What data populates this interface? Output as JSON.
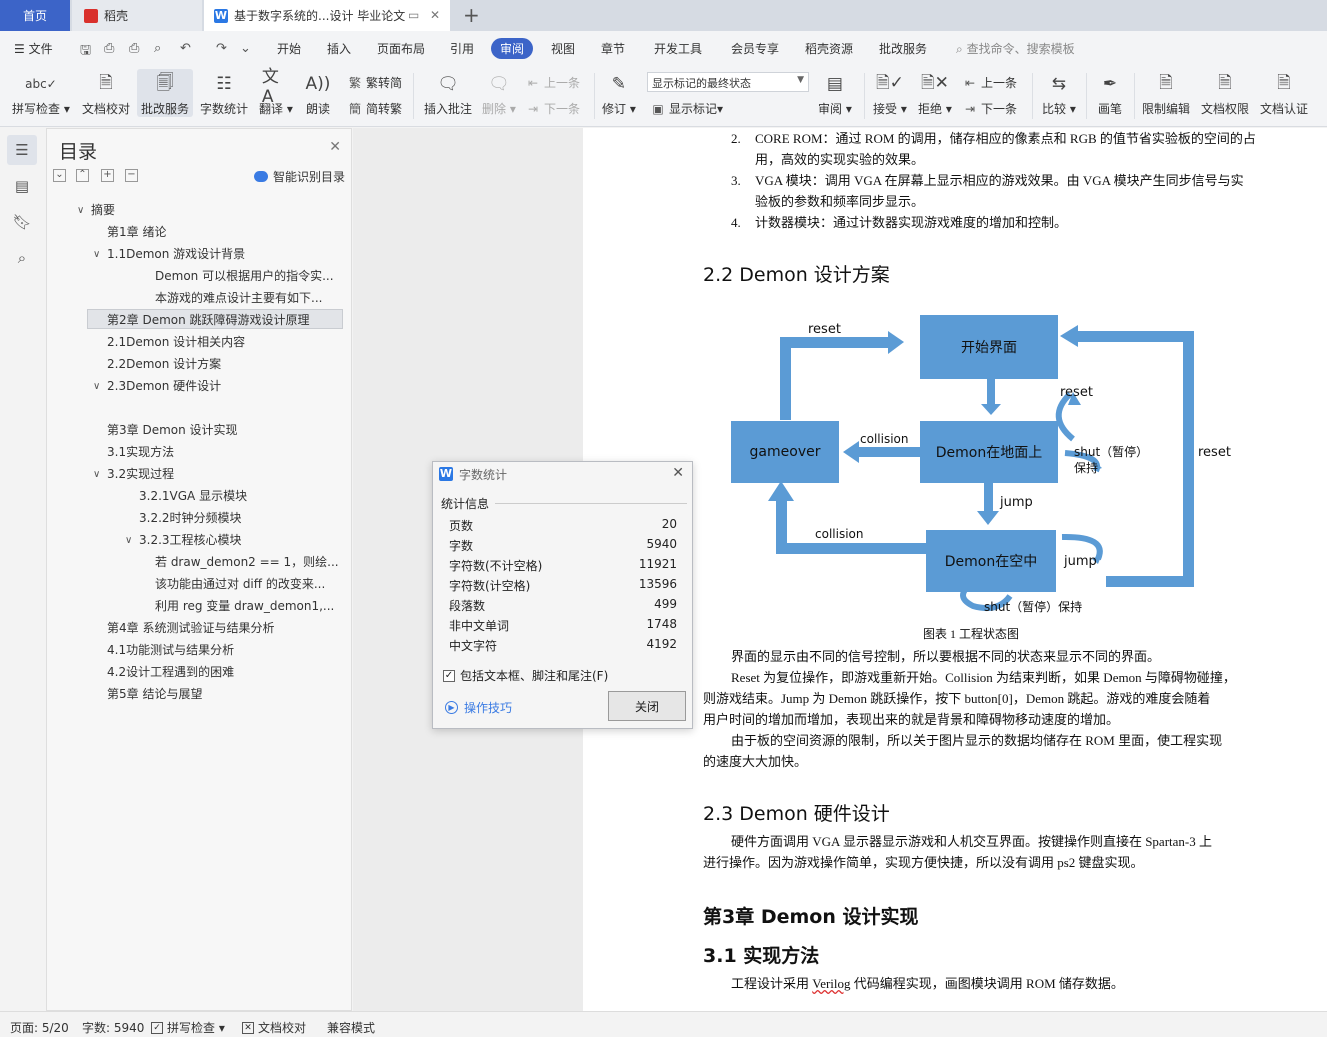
{
  "tabs": {
    "home": "首页",
    "daoke": "稻壳",
    "document": "基于数字系统的...设计 毕业论文"
  },
  "menu": {
    "file": "文件",
    "items": [
      "开始",
      "插入",
      "页面布局",
      "引用",
      "审阅",
      "视图",
      "章节",
      "开发工具",
      "会员专享",
      "稻壳资源",
      "批改服务"
    ],
    "active": "审阅",
    "search_placeholder": "查找命令、搜索模板"
  },
  "ribbon": {
    "spellcheck": "拼写检查",
    "doc_proof": "文档校对",
    "correction_service": "批改服务",
    "word_count": "字数统计",
    "translate": "翻译",
    "read_aloud": "朗读",
    "trad_to_simp": "繁转简",
    "simp_to_trad": "简转繁",
    "insert_comment": "插入批注",
    "delete": "删除",
    "prev_comment": "上一条",
    "next_comment": "下一条",
    "track_changes": "修订",
    "markup_state": "显示标记的最终状态",
    "show_markup": "显示标记",
    "review": "审阅",
    "accept": "接受",
    "reject": "拒绝",
    "prev_change": "上一条",
    "next_change": "下一条",
    "compare": "比较",
    "pen": "画笔",
    "restrict_edit": "限制编辑",
    "doc_permission": "文档权限",
    "doc_certify": "文档认证"
  },
  "toc": {
    "title": "目录",
    "smart_toc": "智能识别目录",
    "items": [
      {
        "text": "摘要"
      },
      {
        "text": "第1章 绪论"
      },
      {
        "text": "1.1Demon 游戏设计背景"
      },
      {
        "text": "Demon 可以根据用户的指令实..."
      },
      {
        "text": "本游戏的难点设计主要有如下..."
      },
      {
        "text": "第2章 Demon 跳跃障碍游戏设计原理"
      },
      {
        "text": "2.1Demon 设计相关内容"
      },
      {
        "text": "2.2Demon 设计方案"
      },
      {
        "text": "2.3Demon 硬件设计"
      },
      {
        "text": "第3章 Demon 设计实现"
      },
      {
        "text": "3.1实现方法"
      },
      {
        "text": "3.2实现过程"
      },
      {
        "text": "3.2.1VGA 显示模块"
      },
      {
        "text": "3.2.2时钟分频模块"
      },
      {
        "text": "3.2.3工程核心模块"
      },
      {
        "text": "若 draw_demon2 == 1，则绘..."
      },
      {
        "text": "该功能由通过对 diff 的改变来..."
      },
      {
        "text": "利用 reg 变量 draw_demon1,..."
      },
      {
        "text": "第4章 系统测试验证与结果分析"
      },
      {
        "text": "4.1功能测试与结果分析"
      },
      {
        "text": "4.2设计工程遇到的困难"
      },
      {
        "text": "第5章 结论与展望"
      }
    ]
  },
  "document": {
    "list_items": [
      {
        "num": "2.",
        "line1": "CORE ROM：通过 ROM 的调用，储存相应的像素点和 RGB 的值节省实验板的空间的占",
        "line2": "用，高效的实现实验的效果。"
      },
      {
        "num": "3.",
        "line1": "VGA 模块：调用 VGA 在屏幕上显示相应的游戏效果。由 VGA 模块产生同步信号与实",
        "line2": "验板的参数和频率同步显示。"
      },
      {
        "num": "4.",
        "line1": "计数器模块：通过计数器实现游戏难度的增加和控制。",
        "line2": ""
      }
    ],
    "h_22": "2.2 Demon 设计方案",
    "diagram": {
      "start": "开始界面",
      "ground": "Demon在地面上",
      "gameover": "gameover",
      "air": "Demon在空中",
      "reset_top": "reset",
      "reset_mid": "reset",
      "reset_right": "reset",
      "collision_top": "collision",
      "collision_bottom": "collision",
      "jump_mid": "jump",
      "jump_right": "jump",
      "shut_pause": "shut（暂停）",
      "hold": "保持",
      "shut_bottom": "shut（暂停）保持"
    },
    "caption": "图表 1 工程状态图",
    "para1": "界面的显示由不同的信号控制，所以要根据不同的状态来显示不同的界面。",
    "para2_l1": "Reset 为复位操作，即游戏重新开始。Collision 为结束判断，如果 Demon 与障碍物碰撞，",
    "para2_l2": "则游戏结束。Jump 为 Demon 跳跃操作，按下 button[0]，Demon 跳起。游戏的难度会随着",
    "para2_l3": "用户时间的增加而增加，表现出来的就是背景和障碍物移动速度的增加。",
    "para3_l1": "由于板的空间资源的限制，所以关于图片显示的数据均储存在 ROM 里面，使工程实现",
    "para3_l2": "的速度大大加快。",
    "h_23": "2.3 Demon 硬件设计",
    "para4_l1": "硬件方面调用 VGA 显示器显示游戏和人机交互界面。按键操作则直接在 Spartan-3 上",
    "para4_l2": "进行操作。因为游戏操作简单，实现方便快捷，所以没有调用 ps2 键盘实现。",
    "h_ch3": "第3章 Demon 设计实现",
    "h_31": "3.1 实现方法",
    "para5_a": "工程设计采用 ",
    "para5_b": "Verilog",
    "para5_c": " 代码编程实现，画图模块调用 ROM 储存数据。"
  },
  "word_count_dialog": {
    "title": "字数统计",
    "section": "统计信息",
    "stats": [
      {
        "label": "页数",
        "value": "20"
      },
      {
        "label": "字数",
        "value": "5940"
      },
      {
        "label": "字符数(不计空格)",
        "value": "11921"
      },
      {
        "label": "字符数(计空格)",
        "value": "13596"
      },
      {
        "label": "段落数",
        "value": "499"
      },
      {
        "label": "非中文单词",
        "value": "1748"
      },
      {
        "label": "中文字符",
        "value": "4192"
      }
    ],
    "include_label": "包括文本框、脚注和尾注(F)",
    "tips": "操作技巧",
    "close": "关闭"
  },
  "statusbar": {
    "page": "页面: 5/20",
    "words": "字数: 5940",
    "spellcheck": "拼写检查",
    "proof": "文档校对",
    "compat": "兼容模式"
  },
  "colors": {
    "accent": "#3c64c8",
    "diagram_blue": "#5b9bd5",
    "link": "#3a7be3"
  }
}
